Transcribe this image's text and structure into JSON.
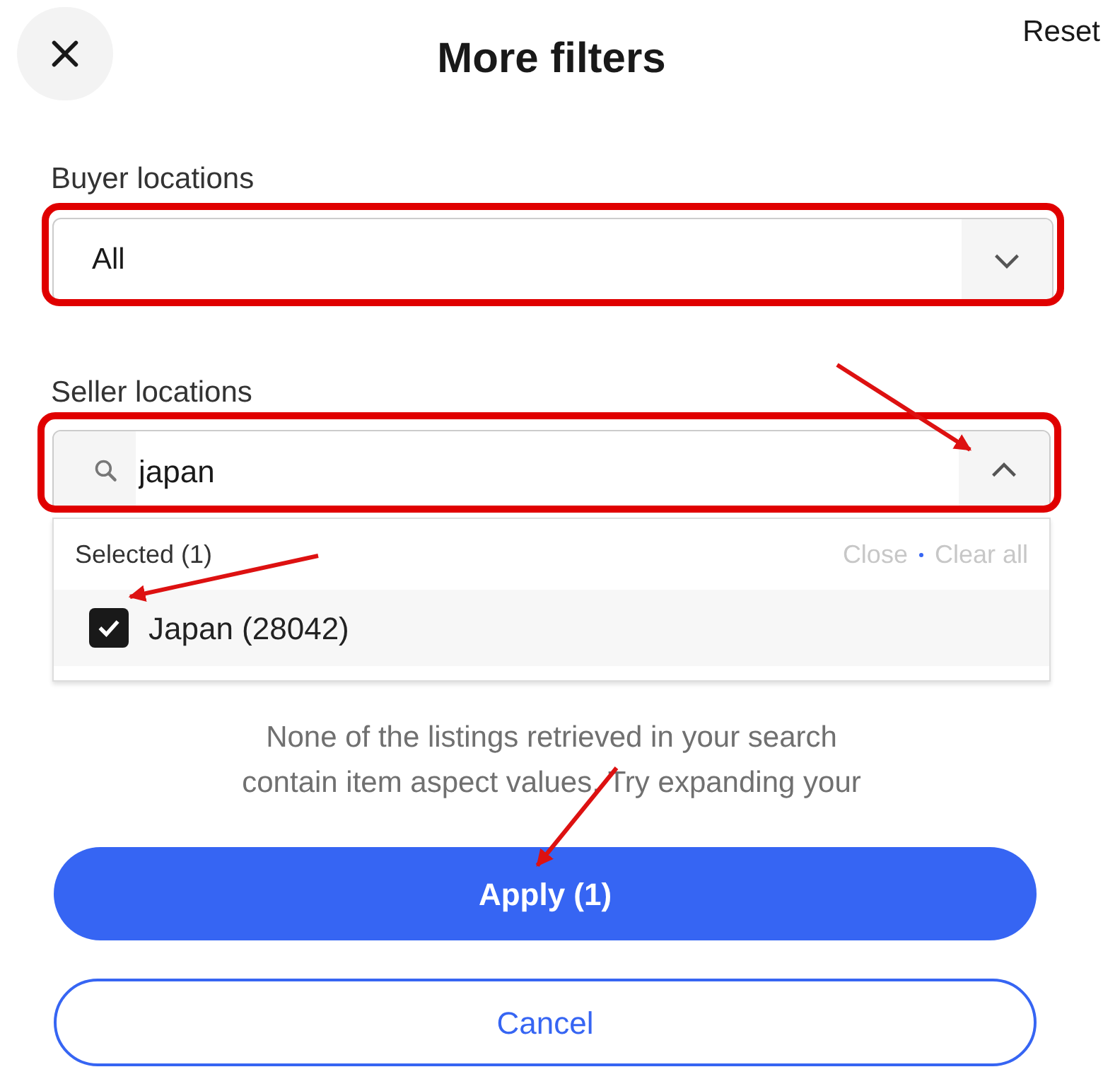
{
  "header": {
    "title": "More filters",
    "reset": "Reset"
  },
  "buyer_locations": {
    "label": "Buyer locations",
    "value": "All",
    "expanded": false
  },
  "seller_locations": {
    "label": "Seller locations",
    "query": "japan",
    "expanded": true,
    "selected_header": "Selected (1)",
    "close_link": "Close",
    "clear_all_link": "Clear all",
    "options": [
      {
        "label": "Japan (28042)",
        "checked": true
      }
    ]
  },
  "message_lines": [
    "None of the listings retrieved in your search",
    "contain item aspect values. Try expanding your"
  ],
  "apply_button": "Apply (1)",
  "cancel_button": "Cancel"
}
